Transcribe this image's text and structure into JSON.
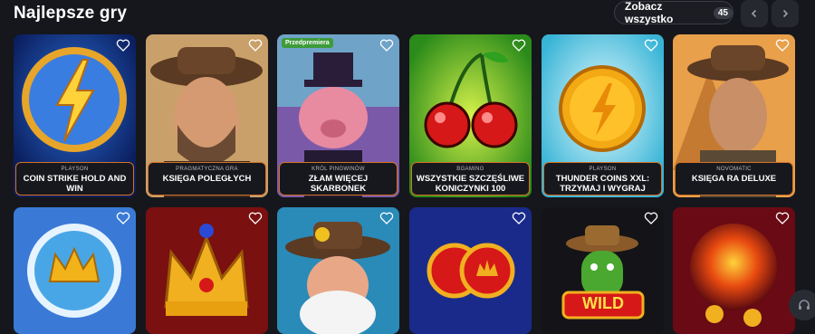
{
  "header": {
    "title": "Najlepsze gry",
    "see_all_label": "Zobacz wszystko",
    "see_all_count": "45",
    "prev_icon": "chevron-left-icon",
    "next_icon": "chevron-right-icon"
  },
  "games_row1": [
    {
      "provider": "PLAYSON",
      "name": "COIN STRIKE HOLD AND WIN"
    },
    {
      "provider": "PRAGMATYCZNA GRA",
      "name": "KSIĘGA POLEGŁYCH"
    },
    {
      "provider": "KRÓL PINGWINÓW",
      "name": "ZŁAM WIĘCEJ SKARBONEK",
      "badge": "Przedpremiera"
    },
    {
      "provider": "BGAMING",
      "name": "WSZYSTKIE SZCZĘŚLIWE KONICZYNKI 100"
    },
    {
      "provider": "PLAYSON",
      "name": "THUNDER COINS XXL: TRZYMAJ I WYGRAJ"
    },
    {
      "provider": "NOVOMATIC",
      "name": "KSIĘGA RA DELUXE"
    }
  ],
  "games_row2_art": [
    "crown-coin",
    "royal-crown",
    "old-miner",
    "twin-coins",
    "cactus-wild",
    "fire-coins"
  ],
  "row2_wild_text": "WILD",
  "colors": {
    "accent_border": "#d4722a",
    "background": "#16171c",
    "badge_green": "#3e9b3a"
  },
  "support_icon": "headset-icon",
  "favorite_icon": "heart-icon"
}
